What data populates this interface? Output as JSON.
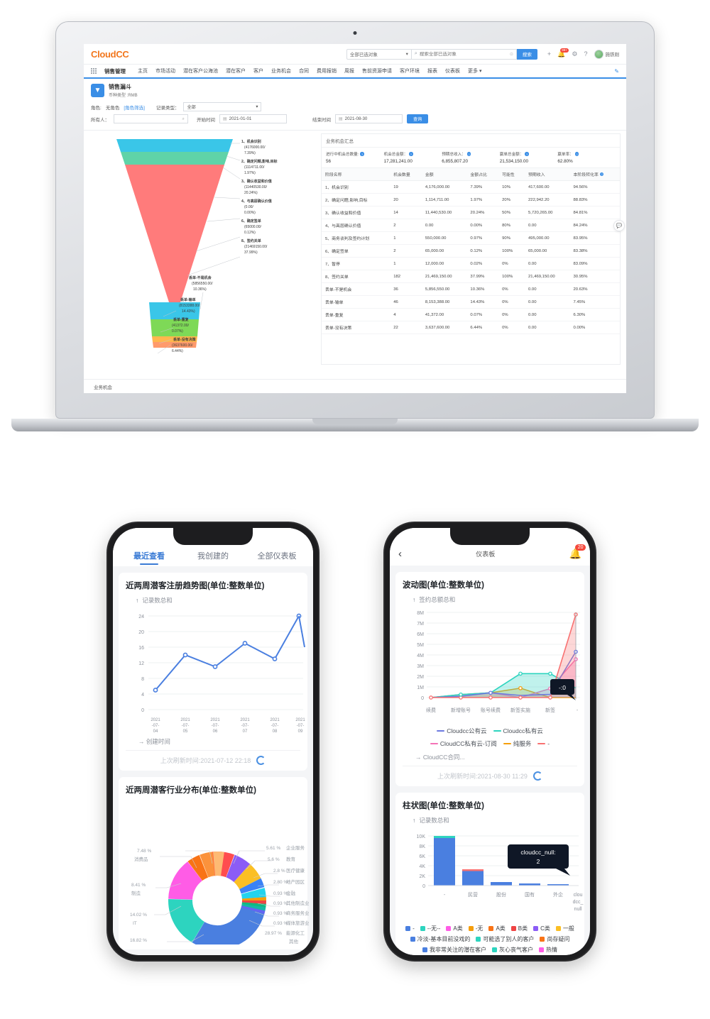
{
  "desktop": {
    "brand": "CloudCC",
    "search": {
      "object_selector": "全部已选对象",
      "placeholder": "搜索全部已选对象",
      "button": "搜索"
    },
    "top_icons": {
      "plus": "+",
      "bell_badge": "99+",
      "gear": "gear-icon",
      "help": "?"
    },
    "user": "施铁刚",
    "nav": {
      "module": "销售管理",
      "items": [
        "主页",
        "市场活动",
        "潜在客户公海池",
        "潜在客户",
        "客户",
        "业务机会",
        "合同",
        "费用报销",
        "周报",
        "售前资源申请",
        "客户环境",
        "报表",
        "仪表板"
      ],
      "more": "更多"
    },
    "page": {
      "title": "销售漏斗",
      "subtitle": "币种类型 :RMB"
    },
    "filters": {
      "role_label": "角色:",
      "role_value": "无角色",
      "role_filter_link": "[角色筛选]",
      "record_type_label": "记录类型：",
      "record_type_value": "全部",
      "owner_label": "所有人：",
      "owner_value": "",
      "start_label": "开始时间",
      "start_value": "2021-01-01",
      "end_label": "结束时间",
      "end_value": "2021-08-30",
      "query_button": "查询"
    },
    "table_panel": {
      "title": "业务机会汇总",
      "summary": [
        {
          "label": "进行中机会总数量:",
          "value": "56"
        },
        {
          "label": "机会总金额：",
          "value": "17,281,241.00"
        },
        {
          "label": "预期总收入：",
          "value": "6,855,807.20"
        },
        {
          "label": "赢单总金额：",
          "value": "21,534,150.00"
        },
        {
          "label": "赢单率：",
          "value": "62.80%"
        }
      ],
      "columns": [
        "阶段名称",
        "机会数量",
        "金额",
        "金额占比",
        "可能性",
        "预期收入",
        "本阶段转化率"
      ],
      "rows": [
        [
          "1、机会识别",
          "19",
          "4,176,000.00",
          "7.39%",
          "10%",
          "417,600.00",
          "94.56%"
        ],
        [
          "2、确定问题,影响,目标",
          "20",
          "1,114,711.00",
          "1.97%",
          "20%",
          "222,942.20",
          "88.83%"
        ],
        [
          "3、确认收益和价值",
          "14",
          "11,440,530.00",
          "20.24%",
          "50%",
          "5,720,265.00",
          "84.81%"
        ],
        [
          "4、与高层确认价值",
          "2",
          "0.00",
          "0.00%",
          "80%",
          "0.00",
          "84.24%"
        ],
        [
          "5、商务谈判及签约计划",
          "1",
          "550,000.00",
          "0.97%",
          "90%",
          "495,000.00",
          "83.95%"
        ],
        [
          "6、确定签单",
          "2",
          "65,000.00",
          "0.12%",
          "100%",
          "65,000.00",
          "83.38%"
        ],
        [
          "7、暂停",
          "1",
          "12,000.00",
          "0.02%",
          "0%",
          "0.00",
          "83.09%"
        ],
        [
          "8、签约关单",
          "182",
          "21,469,150.00",
          "37.99%",
          "100%",
          "21,469,150.00",
          "30.95%"
        ],
        [
          "丢单-不是机会",
          "36",
          "5,856,550.00",
          "10.36%",
          "0%",
          "0.00",
          "20.63%"
        ],
        [
          "丢单-输单",
          "46",
          "8,153,388.00",
          "14.43%",
          "0%",
          "0.00",
          "7.45%"
        ],
        [
          "丢单-重复",
          "4",
          "41,372.00",
          "0.07%",
          "0%",
          "0.00",
          "6.30%"
        ],
        [
          "丢单-没有决策",
          "22",
          "3,637,600.00",
          "6.44%",
          "0%",
          "0.00",
          "0.00%"
        ]
      ]
    },
    "status_bar": "业务机会",
    "funnel_chart": {
      "type": "bar",
      "title": "销售漏斗",
      "categories": [
        "1、机会识别",
        "2、确定问题,影响,目标",
        "3、确认收益和价值",
        "4、与高层确认价值",
        "6、确定签单",
        "8、签约关单",
        "丢单-不是机会",
        "丢单-输单",
        "丢单-重复",
        "丢单-没有决策"
      ],
      "values": [
        4176000,
        1114711,
        11440530,
        0,
        65000,
        21469150,
        5856550,
        8153388,
        41372,
        3637600
      ],
      "percents": [
        7.39,
        1.97,
        20.24,
        0.0,
        0.12,
        37.99,
        10.36,
        14.43,
        0.07,
        6.44
      ],
      "labels": [
        "1、机会识别\n(4176000.00/\n7.39%)",
        "2、确定问题,影响,目标\n(1114711.00/\n1.97%)",
        "3、确认收益和价值\n(11440530.00/\n20.24%)",
        "4、与高层确认价值\n(0.00/\n0.00%)",
        "6、确定签单\n(65000.00/\n0.12%)",
        "8、签约关单\n(21469150.00/\n37.99%)",
        "丢单-不是机会\n(5856550.00/\n10.36%)",
        "丢单-输单\n(8153388.00/\n14.43%)",
        "丢单-重复\n(41372.00/\n0.07%)",
        "丢单-没有决策\n(3637600.00/\n6.44%)"
      ],
      "colors": [
        "#3ac6e8",
        "#5fd3a8",
        "#ff8aa0",
        "#ff7b7b",
        "#ff7b7b",
        "#ff7b7b",
        "#3ac6e8",
        "#7ed957",
        "#ffb74d",
        "#ff9a6c"
      ]
    }
  },
  "phone_left": {
    "tabs": [
      {
        "label": "最近查看",
        "active": true
      },
      {
        "label": "我创建的",
        "active": false
      },
      {
        "label": "全部仪表板",
        "active": false
      }
    ],
    "card1": {
      "title": "近两周潜客注册趋势图(单位:整数单位)",
      "metric": "记录数总和",
      "xaxis": "创建时间",
      "refresh_text": "上次刷新时间:2021-07-12 22:18"
    },
    "card2": {
      "title": "近两周潜客行业分布(单位:整数单位)"
    },
    "chart1_data": {
      "type": "line",
      "title": "近两周潜客注册趋势图(单位:整数单位)",
      "ylabel": "记录数总和",
      "xlabel": "创建时间",
      "categories": [
        "2021-07-04",
        "2021-07-05",
        "2021-07-06",
        "2021-07-07",
        "2021-07-08",
        "2021-07-09"
      ],
      "tick_labels": [
        "2021\n-07-\n04",
        "2021\n-07-\n05",
        "2021\n-07-\n06",
        "2021\n-07-\n07",
        "2021\n-07-\n08",
        "2021\n-07-\n09"
      ],
      "values": [
        5,
        14,
        11,
        17,
        13,
        24
      ],
      "yticks": [
        0,
        4,
        8,
        12,
        16,
        20,
        24
      ],
      "ylim": [
        0,
        26
      ],
      "color": "#4a7fe0",
      "grid": true
    },
    "chart2_data": {
      "type": "pie",
      "title": "近两周潜客行业分布(单位:整数单位)",
      "labels": [
        "消费品",
        "企业服务",
        "教育",
        "医疗健康",
        "地产园区",
        "金融",
        "其他制造业",
        "商务服务业",
        "媒体旅游业",
        "能源化工",
        "其他",
        "IT",
        "制造"
      ],
      "values": [
        7.48,
        5.61,
        5.6,
        2.8,
        2.8,
        0.93,
        0.93,
        0.93,
        0.93,
        0.93,
        28.97,
        14.02,
        16.82
      ],
      "value_labels": [
        "7.48 %",
        "5.61 %",
        "5.6 %",
        "2.8 %",
        "2.80 %",
        "0.93 %",
        "0.93 %",
        "0.93 %",
        "0.93 %",
        "0.93 %",
        "28.97 %",
        "14.02 %",
        "16.82 %"
      ],
      "colors": [
        "#ff4d4f",
        "#8b5cf6",
        "#fbbf24",
        "#3b82f6",
        "#22d3ee",
        "#f59e0b",
        "#ef4444",
        "#10b981",
        "#14b8a6",
        "#6366f1",
        "#4a7fe0",
        "#2dd4bf",
        "#ff5ce6"
      ]
    }
  },
  "phone_right": {
    "header": {
      "back": "chevron-left-icon",
      "title": "仪表板",
      "bell_badge": "20"
    },
    "card1": {
      "title": "波动图(单位:整数单位)",
      "metric": "签约总额总和",
      "xaxis": "CloudCC合同...",
      "refresh_text": "上次刷新时间:2021-08-30 11:29",
      "tooltip": "-:0"
    },
    "card2": {
      "title": "柱状图(单位:整数单位)",
      "metric": "记录数总和",
      "tooltip": "cloudcc_null:\n2"
    },
    "chart1_data": {
      "type": "area",
      "title": "波动图(单位:整数单位)",
      "ylabel": "签约总额总和",
      "xlabel": "CloudCC合同...",
      "categories": [
        "续费",
        "新增账号",
        "账号续费",
        "新签实施",
        "新签",
        "-"
      ],
      "yticks": [
        "0",
        "1M",
        "2M",
        "3M",
        "4M",
        "5M",
        "6M",
        "7M",
        "8M"
      ],
      "ylim": [
        0,
        8000000
      ],
      "series": [
        {
          "name": "Cloudcc公有云",
          "color": "#6c7ae0",
          "values": [
            0,
            0.12,
            0.45,
            0.2,
            0.3,
            4.3
          ]
        },
        {
          "name": "Cloudcc私有云",
          "color": "#2dd4bf",
          "values": [
            0,
            0.28,
            0.08,
            2.25,
            2.25,
            0.9
          ]
        },
        {
          "name": "CloudCC私有云-订阅",
          "color": "#f472b6",
          "values": [
            0,
            0,
            0,
            0,
            0.85,
            3.6
          ]
        },
        {
          "name": "纯服务",
          "color": "#f59e0b",
          "values": [
            0,
            0,
            0,
            0.88,
            0,
            0
          ]
        },
        {
          "name": "-",
          "color": "#f87171",
          "values": [
            0,
            0,
            0,
            0,
            0,
            7.8
          ]
        }
      ],
      "units": "M"
    },
    "chart2_data": {
      "type": "bar",
      "title": "柱状图(单位:整数单位)",
      "ylabel": "记录数总和",
      "categories": [
        "-",
        "民营",
        "股份",
        "国有",
        "外企",
        "cloudcc_null"
      ],
      "values": [
        10000,
        3300,
        700,
        400,
        250,
        2
      ],
      "yticks": [
        "0",
        "2K",
        "4K",
        "6K",
        "8K",
        "10K"
      ],
      "ylim": [
        0,
        10500
      ],
      "color": "#4a7fe0"
    },
    "legend_wave": [
      {
        "label": "Cloudcc公有云",
        "color": "#6c7ae0"
      },
      {
        "label": "Cloudcc私有云",
        "color": "#2dd4bf"
      },
      {
        "label": "CloudCC私有云-订阅",
        "color": "#f472b6"
      },
      {
        "label": "纯服务",
        "color": "#f59e0b"
      },
      {
        "label": "-",
        "color": "#f87171"
      }
    ],
    "legend_bar": [
      {
        "label": "-",
        "color": "#4a7fe0"
      },
      {
        "label": "--无--",
        "color": "#2dd4bf"
      },
      {
        "label": "A类",
        "color": "#ff5ce6"
      },
      {
        "label": "-无",
        "color": "#f59e0b"
      },
      {
        "label": "A类",
        "color": "#f97316"
      },
      {
        "label": "B类",
        "color": "#ef4444"
      },
      {
        "label": "C类",
        "color": "#8b5cf6"
      },
      {
        "label": "一般",
        "color": "#fbbf24"
      },
      {
        "label": "冷淡-基本目前没戏的",
        "color": "#4a7fe0"
      },
      {
        "label": "可能选了别人的客户",
        "color": "#2dd4bf"
      },
      {
        "label": "尚存疑问",
        "color": "#f97316"
      },
      {
        "label": "我非常关注的潜在客户",
        "color": "#4a7fe0"
      },
      {
        "label": "灰心丧气客户",
        "color": "#2dd4bf"
      },
      {
        "label": "热情",
        "color": "#ff5ce6"
      }
    ]
  }
}
